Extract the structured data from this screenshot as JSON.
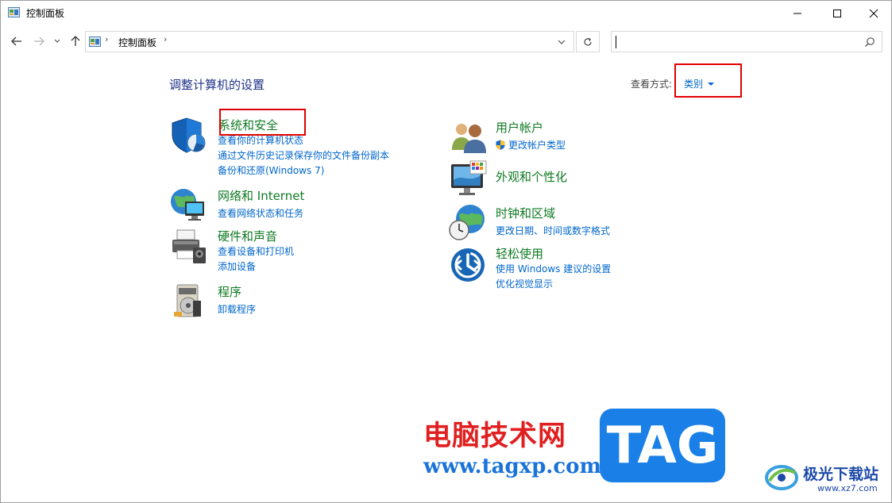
{
  "window": {
    "title": "控制面板"
  },
  "address": {
    "crumb": "控制面板",
    "search_placeholder": ""
  },
  "content": {
    "heading": "调整计算机的设置",
    "view_label": "查看方式:",
    "view_value": "类别"
  },
  "categories": [
    {
      "title": "系统和安全",
      "links": [
        "查看你的计算机状态",
        "通过文件历史记录保存你的文件备份副本",
        "备份和还原(Windows 7)"
      ]
    },
    {
      "title": "网络和 Internet",
      "links": [
        "查看网络状态和任务"
      ]
    },
    {
      "title": "硬件和声音",
      "links": [
        "查看设备和打印机",
        "添加设备"
      ]
    },
    {
      "title": "程序",
      "links": [
        "卸载程序"
      ]
    },
    {
      "title": "用户帐户",
      "links": [
        "更改帐户类型"
      ]
    },
    {
      "title": "外观和个性化",
      "links": []
    },
    {
      "title": "时钟和区域",
      "links": [
        "更改日期、时间或数字格式"
      ]
    },
    {
      "title": "轻松使用",
      "links": [
        "使用 Windows 建议的设置",
        "优化视觉显示"
      ]
    }
  ],
  "watermark": {
    "cn": "电脑技术网",
    "url": "www.tagxp.com",
    "tag": "TAG",
    "site_cn": "极光下载站",
    "site_url": "www.xz7.com"
  },
  "colors": {
    "category_title": "#0e7a22",
    "link": "#0066cc",
    "heading": "#1e3287",
    "highlight": "#e00000"
  }
}
